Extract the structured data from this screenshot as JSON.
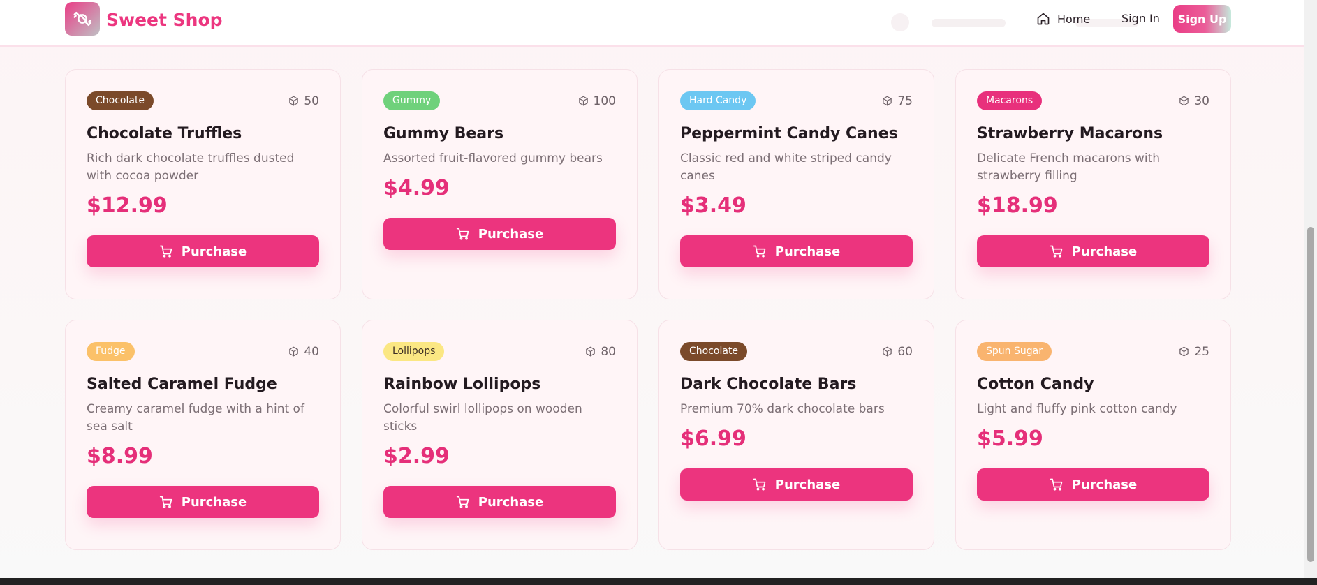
{
  "header": {
    "brand": "Sweet Shop",
    "nav": {
      "home": "Home",
      "sign_in": "Sign In",
      "sign_up": "Sign Up"
    }
  },
  "products": [
    {
      "category": "Chocolate",
      "badge_bg": "#7b4a2a",
      "badge_fg": "#ffffff",
      "stock": "50",
      "name": "Chocolate Truffles",
      "description": "Rich dark chocolate truffles dusted with cocoa powder",
      "price": "$12.99",
      "button": "Purchase"
    },
    {
      "category": "Gummy",
      "badge_bg": "#6fd17b",
      "badge_fg": "#ffffff",
      "stock": "100",
      "name": "Gummy Bears",
      "description": "Assorted fruit-flavored gummy bears",
      "price": "$4.99",
      "button": "Purchase"
    },
    {
      "category": "Hard Candy",
      "badge_bg": "#6cc7f2",
      "badge_fg": "#ffffff",
      "stock": "75",
      "name": "Peppermint Candy Canes",
      "description": "Classic red and white striped candy canes",
      "price": "$3.49",
      "button": "Purchase"
    },
    {
      "category": "Macarons",
      "badge_bg": "#e8307c",
      "badge_fg": "#ffffff",
      "stock": "30",
      "name": "Strawberry Macarons",
      "description": "Delicate French macarons with strawberry filling",
      "price": "$18.99",
      "button": "Purchase"
    },
    {
      "category": "Fudge",
      "badge_bg": "#fbc169",
      "badge_fg": "#ffffff",
      "stock": "40",
      "name": "Salted Caramel Fudge",
      "description": "Creamy caramel fudge with a hint of sea salt",
      "price": "$8.99",
      "button": "Purchase"
    },
    {
      "category": "Lollipops",
      "badge_bg": "#fbe783",
      "badge_fg": "#3c2e24",
      "stock": "80",
      "name": "Rainbow Lollipops",
      "description": "Colorful swirl lollipops on wooden sticks",
      "price": "$2.99",
      "button": "Purchase"
    },
    {
      "category": "Chocolate",
      "badge_bg": "#7b4a2a",
      "badge_fg": "#ffffff",
      "stock": "60",
      "name": "Dark Chocolate Bars",
      "description": "Premium 70% dark chocolate bars",
      "price": "$6.99",
      "button": "Purchase"
    },
    {
      "category": "Spun Sugar",
      "badge_bg": "#f9b46f",
      "badge_fg": "#ffffff",
      "stock": "25",
      "name": "Cotton Candy",
      "description": "Light and fluffy pink cotton candy",
      "price": "$5.99",
      "button": "Purchase"
    }
  ],
  "icons": {
    "logo": "candy-icon",
    "home": "home-icon",
    "stock": "package-icon",
    "cart": "cart-icon"
  }
}
